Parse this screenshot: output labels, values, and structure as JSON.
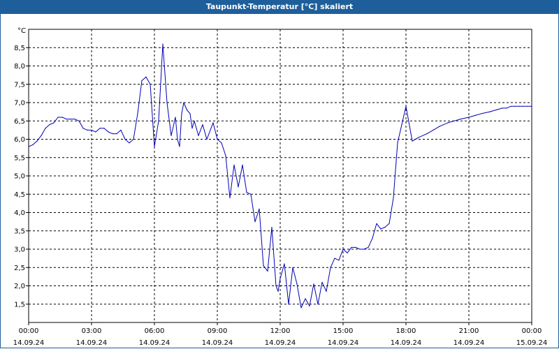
{
  "window": {
    "title": "Taupunkt-Temperatur [°C] skaliert"
  },
  "chart_data": {
    "type": "line",
    "title": "Taupunkt-Temperatur [°C] skaliert",
    "ylabel": "°C",
    "xlabel": "",
    "ylim": [
      1.0,
      9.0
    ],
    "y_ticks": [
      "1,5",
      "2,0",
      "2,5",
      "3,0",
      "3,5",
      "4,0",
      "4,5",
      "5,0",
      "5,5",
      "6,0",
      "6,5",
      "7,0",
      "7,5",
      "8,0",
      "8,5"
    ],
    "x_ticks": [
      {
        "time": "00:00",
        "date": "14.09.24"
      },
      {
        "time": "03:00",
        "date": "14.09.24"
      },
      {
        "time": "06:00",
        "date": "14.09.24"
      },
      {
        "time": "09:00",
        "date": "14.09.24"
      },
      {
        "time": "12:00",
        "date": "14.09.24"
      },
      {
        "time": "15:00",
        "date": "14.09.24"
      },
      {
        "time": "18:00",
        "date": "14.09.24"
      },
      {
        "time": "21:00",
        "date": "14.09.24"
      },
      {
        "time": "00:00",
        "date": "15.09.24"
      }
    ],
    "grid": true,
    "line_color": "#0000b4",
    "x_unit": "hours since 14.09.24 00:00",
    "series": [
      {
        "name": "",
        "x": [
          0,
          0.2,
          0.4,
          0.6,
          0.8,
          1.0,
          1.2,
          1.4,
          1.6,
          1.8,
          2.0,
          2.2,
          2.4,
          2.6,
          2.8,
          3.0,
          3.2,
          3.4,
          3.6,
          3.8,
          4.0,
          4.2,
          4.4,
          4.6,
          4.8,
          5.0,
          5.2,
          5.4,
          5.6,
          5.8,
          6.0,
          6.2,
          6.4,
          6.6,
          6.8,
          7.0,
          7.1,
          7.2,
          7.3,
          7.4,
          7.55,
          7.7,
          7.8,
          7.9,
          8.0,
          8.1,
          8.3,
          8.5,
          8.8,
          9.0,
          9.2,
          9.4,
          9.6,
          9.8,
          10.0,
          10.2,
          10.4,
          10.6,
          10.8,
          11.0,
          11.2,
          11.4,
          11.6,
          11.8,
          11.9,
          12.0,
          12.2,
          12.4,
          12.6,
          12.8,
          13.0,
          13.2,
          13.4,
          13.6,
          13.8,
          14.0,
          14.2,
          14.4,
          14.6,
          14.8,
          15.0,
          15.2,
          15.4,
          15.6,
          15.8,
          16.0,
          16.2,
          16.4,
          16.6,
          16.8,
          17.0,
          17.2,
          17.4,
          17.6,
          17.8,
          18.0,
          18.3,
          18.6,
          19.0,
          19.3,
          19.6,
          20.0,
          20.3,
          20.6,
          21.0,
          21.3,
          21.6,
          22.0,
          22.3,
          22.6,
          22.8,
          23.0,
          23.2,
          23.4,
          23.6,
          23.8,
          24.0
        ],
        "y": [
          5.8,
          5.85,
          5.95,
          6.1,
          6.3,
          6.4,
          6.45,
          6.6,
          6.6,
          6.55,
          6.55,
          6.55,
          6.5,
          6.3,
          6.25,
          6.25,
          6.2,
          6.3,
          6.3,
          6.2,
          6.15,
          6.15,
          6.25,
          6.0,
          5.9,
          6.0,
          6.7,
          7.6,
          7.7,
          7.5,
          5.8,
          6.5,
          8.6,
          7.0,
          6.1,
          6.6,
          6.0,
          5.8,
          6.7,
          7.0,
          6.8,
          6.7,
          6.3,
          6.5,
          6.3,
          6.1,
          6.4,
          6.0,
          6.45,
          6.0,
          5.9,
          5.55,
          4.4,
          5.3,
          4.7,
          5.3,
          4.55,
          4.5,
          3.75,
          4.1,
          2.55,
          2.4,
          3.6,
          2.0,
          1.85,
          2.2,
          2.6,
          1.5,
          2.5,
          2.05,
          1.4,
          1.65,
          1.45,
          2.05,
          1.5,
          2.1,
          1.85,
          2.5,
          2.75,
          2.7,
          3.0,
          2.9,
          3.05,
          3.05,
          3.0,
          3.0,
          3.05,
          3.3,
          3.7,
          3.55,
          3.6,
          3.7,
          4.4,
          5.9,
          6.4,
          6.9,
          5.95,
          6.05,
          6.15,
          6.25,
          6.35,
          6.45,
          6.5,
          6.55,
          6.6,
          6.65,
          6.7,
          6.75,
          6.8,
          6.85,
          6.85,
          6.9,
          6.9,
          6.9,
          6.9,
          6.9,
          6.9
        ]
      }
    ]
  }
}
